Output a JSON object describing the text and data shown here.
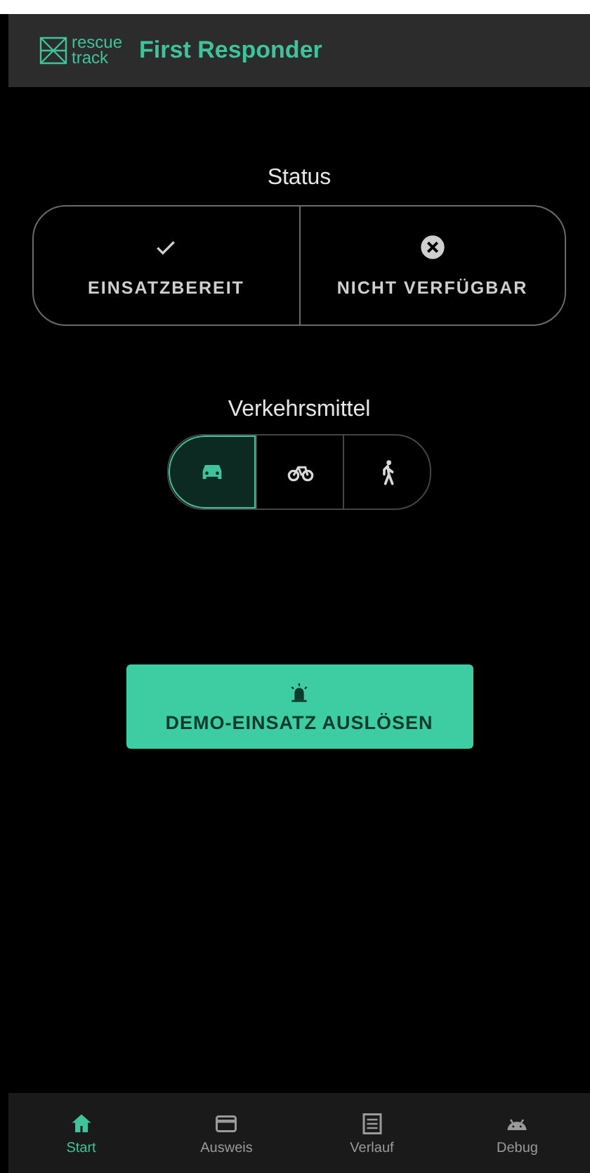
{
  "app_bar": {
    "logo": [
      "rescue",
      "track"
    ],
    "title": "First Responder"
  },
  "status": {
    "title": "Status",
    "options": [
      {
        "label": "EINSATZBEREIT",
        "kind": "check"
      },
      {
        "label": "NICHT VERFÜGBAR",
        "kind": "cancel"
      }
    ]
  },
  "transport": {
    "title": "Verkehrsmittel",
    "options": [
      {
        "kind": "car",
        "selected": true
      },
      {
        "kind": "bike",
        "selected": false
      },
      {
        "kind": "walk",
        "selected": false
      }
    ]
  },
  "demo_button": {
    "label": "DEMO-EINSATZ AUSLÖSEN"
  },
  "bottom_nav": [
    {
      "label": "Start",
      "kind": "home",
      "selected": true
    },
    {
      "label": "Ausweis",
      "kind": "card",
      "selected": false
    },
    {
      "label": "Verlauf",
      "kind": "list",
      "selected": false
    },
    {
      "label": "Debug",
      "kind": "robot",
      "selected": false
    }
  ]
}
